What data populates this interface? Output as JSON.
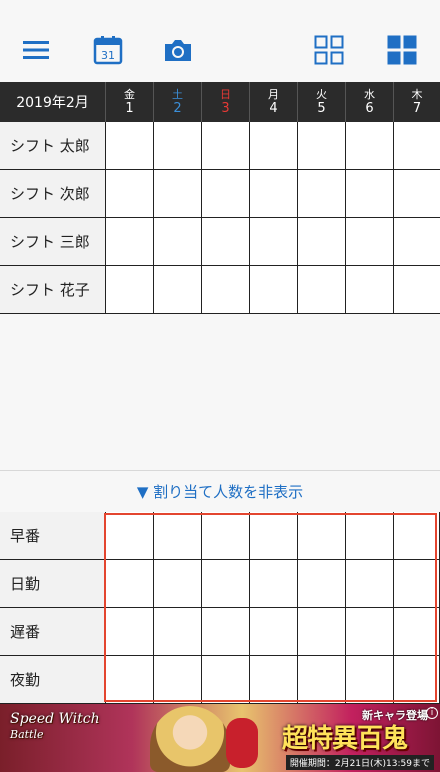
{
  "colors": {
    "accent": "#1f6fc4",
    "header_bg": "#2b2b2b",
    "saturday": "#3b8fd9",
    "sunday": "#e53935",
    "highlight": "#e3452f"
  },
  "toolbar": {
    "icons": [
      "menu-icon",
      "calendar-icon",
      "camera-icon",
      "grid-outline-icon",
      "grid-filled-icon"
    ],
    "calendar_day": "31"
  },
  "calendar": {
    "month_label": "2019年2月",
    "days": [
      {
        "weekday": "金",
        "date": "1",
        "type": "weekday"
      },
      {
        "weekday": "土",
        "date": "2",
        "type": "saturday"
      },
      {
        "weekday": "日",
        "date": "3",
        "type": "sunday"
      },
      {
        "weekday": "月",
        "date": "4",
        "type": "weekday"
      },
      {
        "weekday": "火",
        "date": "5",
        "type": "weekday"
      },
      {
        "weekday": "水",
        "date": "6",
        "type": "weekday"
      },
      {
        "weekday": "木",
        "date": "7",
        "type": "weekday"
      }
    ]
  },
  "staff": [
    "シフト 太郎",
    "シフト 次郎",
    "シフト 三郎",
    "シフト 花子"
  ],
  "toggle_label": "▼ 割り当て人数を非表示",
  "shifts": [
    "早番",
    "日勤",
    "遅番",
    "夜勤"
  ],
  "ad": {
    "logo_line1": "Speed Witch",
    "logo_line2": "Battle",
    "new_label": "新キャラ登場",
    "headline": "超特異百鬼",
    "period": "開催期間：2月21日(木)13:59まで"
  }
}
